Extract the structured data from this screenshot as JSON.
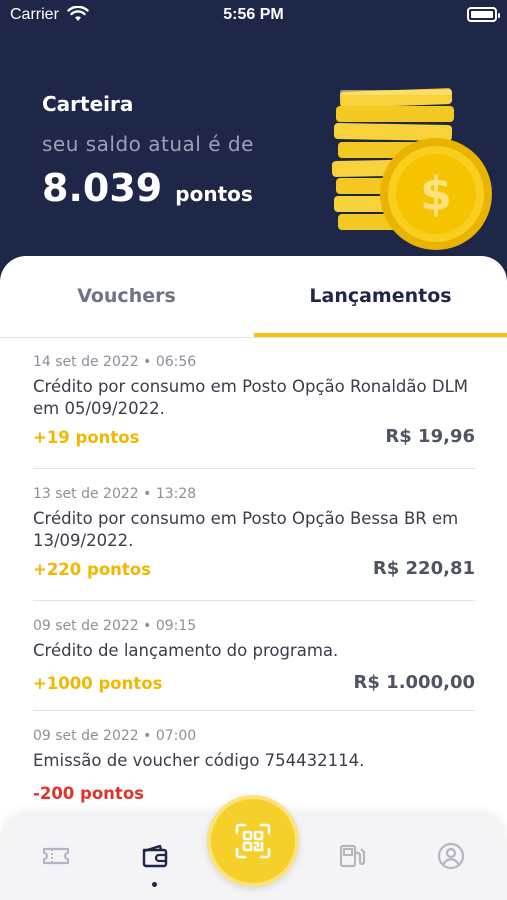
{
  "status_bar": {
    "carrier": "Carrier",
    "time": "5:56 PM"
  },
  "header": {
    "title": "Carteira",
    "balance_caption": "seu saldo atual é de",
    "balance_value": "8.039",
    "balance_unit": "pontos"
  },
  "tabs": [
    {
      "label": "Vouchers",
      "active": false
    },
    {
      "label": "Lançamentos",
      "active": true
    }
  ],
  "entries": [
    {
      "date": "14 set de 2022 • 06:56",
      "description": "Crédito por consumo em Posto Opção Ronaldão DLM em 05/09/2022.",
      "points": "+19 pontos",
      "amount": "R$ 19,96"
    },
    {
      "date": "13 set de 2022 • 13:28",
      "description": "Crédito por consumo em Posto Opção Bessa BR em 13/09/2022.",
      "points": "+220 pontos",
      "amount": "R$ 220,81"
    },
    {
      "date": "09 set de 2022 • 09:15",
      "description": "Crédito de lançamento do programa.",
      "points": "+1000 pontos",
      "amount": "R$ 1.000,00"
    },
    {
      "date": "09 set de 2022 • 07:00",
      "description": "Emissão de voucher código 754432114.",
      "points": "-200 pontos",
      "amount": ""
    }
  ],
  "bottom_nav": [
    {
      "icon": "ticket-icon",
      "active": false
    },
    {
      "icon": "wallet-icon",
      "active": true
    },
    {
      "icon": "qr-code-icon",
      "active": false
    },
    {
      "icon": "fuel-pump-icon",
      "active": false
    },
    {
      "icon": "user-icon",
      "active": false
    }
  ],
  "colors": {
    "header_bg": "#1f2748",
    "accent": "#f2c40f",
    "positive_points": "#f2b800",
    "negative_points": "#e0322a"
  }
}
